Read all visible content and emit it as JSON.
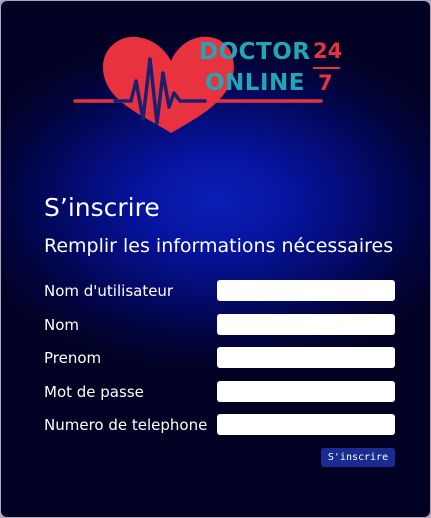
{
  "logo": {
    "line1": "DOCTOR",
    "line2": "ONLINE",
    "numerator": "24",
    "denominator": "7",
    "colors": {
      "text": "#21a6b4",
      "heart": "#e8323f",
      "pulse": "#1a1f6e"
    }
  },
  "form": {
    "title": "S’inscrire",
    "subtitle": "Remplir les informations nécessaires",
    "fields": [
      {
        "label": "Nom d'utilisateur",
        "value": ""
      },
      {
        "label": "Nom",
        "value": ""
      },
      {
        "label": "Prenom",
        "value": ""
      },
      {
        "label": "Mot de passe",
        "value": ""
      },
      {
        "label": "Numero de telephone",
        "value": ""
      }
    ],
    "submit_label": "S'inscrire"
  },
  "colors": {
    "background_center": "#0a1fb5",
    "background_edge": "#010223",
    "button": "#1a2b92"
  }
}
